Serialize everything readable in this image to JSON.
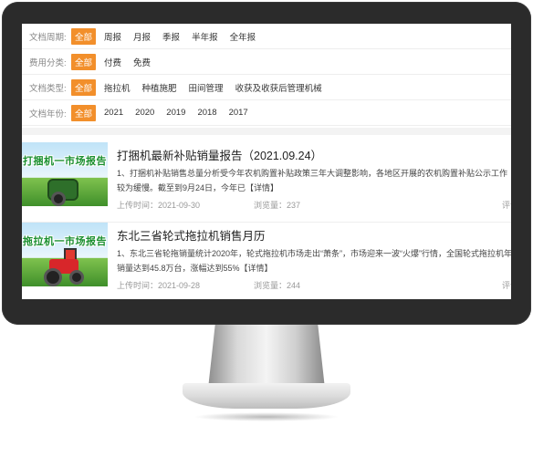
{
  "filters": [
    {
      "label": "文档周期:",
      "options": [
        "全部",
        "周报",
        "月报",
        "季报",
        "半年报",
        "全年报"
      ],
      "active": 0
    },
    {
      "label": "费用分类:",
      "options": [
        "全部",
        "付费",
        "免费"
      ],
      "active": 0
    },
    {
      "label": "文档类型:",
      "options": [
        "全部",
        "拖拉机",
        "种植施肥",
        "田间管理",
        "收获及收获后管理机械"
      ],
      "active": 0
    },
    {
      "label": "文档年份:",
      "options": [
        "全部",
        "2021",
        "2020",
        "2019",
        "2018",
        "2017"
      ],
      "active": 0
    }
  ],
  "articles": [
    {
      "thumb_text": "打捆机一市场报告",
      "thumb_icon": "baler-machine-illustration",
      "title": "打捆机最新补贴销量报告（2021.09.24）",
      "desc": "1、打捆机补贴销售总量分析受今年农机购置补贴政策三年大调整影响，各地区开展的农机购置补贴公示工作较为缓慢。截至到9月24日，今年已",
      "more": "【详情】",
      "upload_label": "上传时间：2021-09-30",
      "views_label": "浏览量：237",
      "comment_label": "评论"
    },
    {
      "thumb_text": "拖拉机一市场报告",
      "thumb_icon": "tractor-illustration",
      "title": "东北三省轮式拖拉机销售月历",
      "desc": "1、东北三省轮拖销量统计2020年，轮式拖拉机市场走出“萧条”，市场迎来一波“火爆”行情，全国轮式拖拉机年销量达到45.8万台，涨幅达到55%",
      "more": "【详情】",
      "upload_label": "上传时间：2021-09-28",
      "views_label": "浏览量：244",
      "comment_label": "评论"
    }
  ],
  "colors": {
    "accent": "#f28f2b",
    "bezel": "#2b2b2b"
  }
}
